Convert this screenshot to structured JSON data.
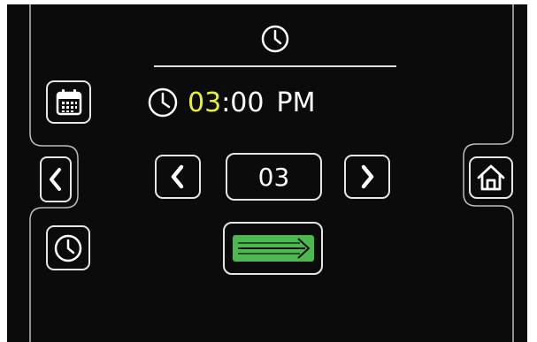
{
  "time_display": {
    "hour": "03",
    "separator": ":",
    "minutes": "00",
    "period": "PM"
  },
  "selector": {
    "value": "03"
  },
  "colors": {
    "background": "#0b0b0b",
    "outline": "#e6e6e6",
    "hour_highlight": "#e6ee3a",
    "confirm_green": "#4cb84f"
  },
  "icons": {
    "header": "clock-icon",
    "calendar_button": "calendar-icon",
    "clock_button": "clock-icon",
    "back_button": "chevron-left-icon",
    "decrement": "chevron-left-icon",
    "increment": "chevron-right-icon",
    "home_button": "home-icon",
    "confirm_button": "arrow-right-icon"
  }
}
